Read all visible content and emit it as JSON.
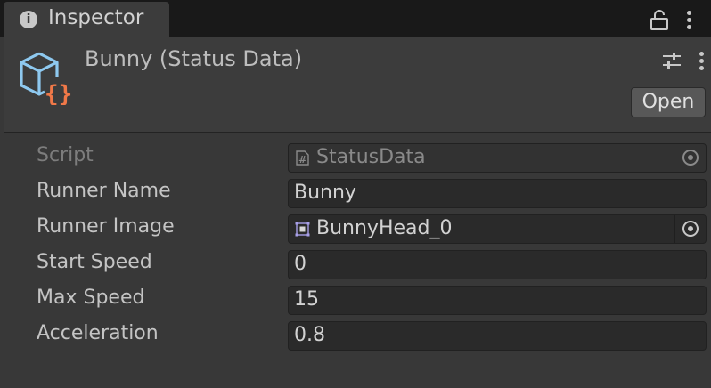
{
  "tab": {
    "label": "Inspector",
    "icon": "info-icon"
  },
  "header": {
    "title": "Bunny (Status Data)",
    "asset_icon": "scriptable-object-icon",
    "open_label": "Open"
  },
  "fields": {
    "script": {
      "label": "Script",
      "value": "StatusData",
      "icon": "csharp-script-icon"
    },
    "runner_name": {
      "label": "Runner Name",
      "value": "Bunny"
    },
    "runner_image": {
      "label": "Runner Image",
      "value": "BunnyHead_0",
      "icon": "sprite-icon"
    },
    "start_speed": {
      "label": "Start Speed",
      "value": "0"
    },
    "max_speed": {
      "label": "Max Speed",
      "value": "15"
    },
    "acceleration": {
      "label": "Acceleration",
      "value": "0.8"
    }
  },
  "colors": {
    "asset_icon_blue": "#8ec9f0",
    "asset_icon_orange": "#f07848",
    "background": "#383838"
  }
}
